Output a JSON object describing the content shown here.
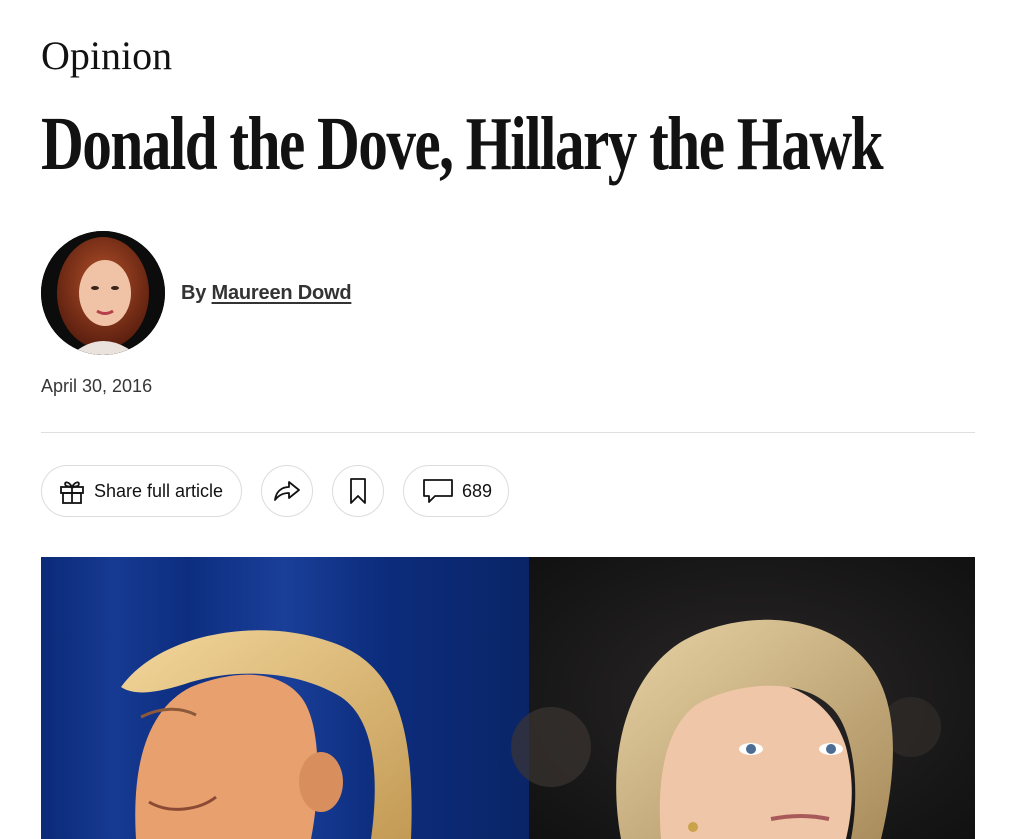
{
  "section": {
    "label": "Opinion"
  },
  "article": {
    "headline": "Donald the Dove, Hillary the Hawk",
    "byline_prefix": "By",
    "author": "Maureen Dowd",
    "date": "April 30, 2016"
  },
  "toolbar": {
    "share_label": "Share full article",
    "comment_count": "689",
    "icons": {
      "share_gift": "gift-icon",
      "forward": "share-arrow-icon",
      "bookmark": "bookmark-icon",
      "comments": "comment-icon"
    }
  },
  "colors": {
    "text": "#121212",
    "rule": "#dfdfdf",
    "pill_border": "#dcdcdc",
    "photo_left_bg": "#0f2d7a",
    "photo_right_bg": "#1c1b1b"
  }
}
